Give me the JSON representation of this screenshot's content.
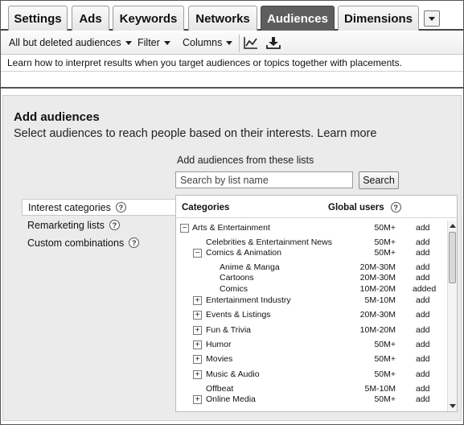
{
  "tabs": [
    {
      "label": "Settings",
      "active": false
    },
    {
      "label": "Ads",
      "active": false
    },
    {
      "label": "Keywords",
      "active": false
    },
    {
      "label": "Networks",
      "active": false
    },
    {
      "label": "Audiences",
      "active": true
    },
    {
      "label": "Dimensions",
      "active": false
    }
  ],
  "toolbar": {
    "filter_view": "All but deleted audiences",
    "filter": "Filter",
    "columns": "Columns",
    "chart_icon": "line-chart-icon",
    "download_icon": "download-icon"
  },
  "info_text": "Learn how to interpret results when you target audiences or topics together with placements.",
  "add_audiences": {
    "title": "Add audiences",
    "subtitle": "Select audiences to reach people based on their interests.",
    "learn_more": "Learn more",
    "lists_label": "Add audiences from these lists",
    "search_placeholder": "Search by list name",
    "search_button": "Search"
  },
  "left_nav": [
    {
      "label": "Interest categories",
      "active": true
    },
    {
      "label": "Remarketing lists",
      "active": false
    },
    {
      "label": "Custom combinations",
      "active": false
    }
  ],
  "table": {
    "col_categories": "Categories",
    "col_users": "Global users",
    "rows": [
      {
        "label": "Arts & Entertainment",
        "level": 0,
        "toggle": "minus",
        "users": "50M+",
        "action": "add"
      },
      {
        "label": "Celebrities & Entertainment News",
        "level": 1,
        "toggle": "none",
        "users": "50M+",
        "action": "add"
      },
      {
        "label": "Comics & Animation",
        "level": 1,
        "toggle": "minus",
        "users": "50M+",
        "action": "add"
      },
      {
        "label": "Anime & Manga",
        "level": 2,
        "toggle": "none",
        "users": "20M-30M",
        "action": "add"
      },
      {
        "label": "Cartoons",
        "level": 2,
        "toggle": "none",
        "users": "20M-30M",
        "action": "add"
      },
      {
        "label": "Comics",
        "level": 2,
        "toggle": "none",
        "users": "10M-20M",
        "action": "added"
      },
      {
        "label": "Entertainment Industry",
        "level": 1,
        "toggle": "plus",
        "users": "5M-10M",
        "action": "add"
      },
      {
        "label": "Events & Listings",
        "level": 1,
        "toggle": "plus",
        "users": "20M-30M",
        "action": "add"
      },
      {
        "label": "Fun & Trivia",
        "level": 1,
        "toggle": "plus",
        "users": "10M-20M",
        "action": "add"
      },
      {
        "label": "Humor",
        "level": 1,
        "toggle": "plus",
        "users": "50M+",
        "action": "add"
      },
      {
        "label": "Movies",
        "level": 1,
        "toggle": "plus",
        "users": "50M+",
        "action": "add"
      },
      {
        "label": "Music & Audio",
        "level": 1,
        "toggle": "plus",
        "users": "50M+",
        "action": "add"
      },
      {
        "label": "Offbeat",
        "level": 1,
        "toggle": "none",
        "users": "5M-10M",
        "action": "add"
      },
      {
        "label": "Online Media",
        "level": 1,
        "toggle": "plus",
        "users": "50M+",
        "action": "add"
      }
    ]
  }
}
